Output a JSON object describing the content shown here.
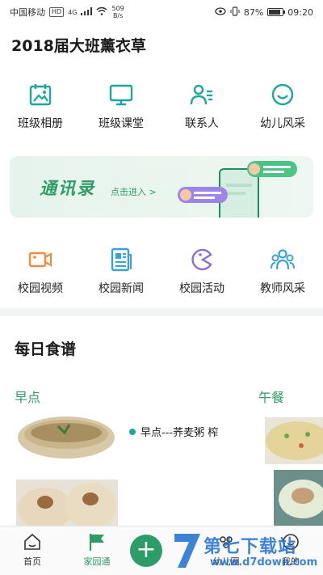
{
  "status_bar": {
    "carrier": "中国移动",
    "hd": "HD",
    "network": "4G",
    "speed_value": "509",
    "speed_unit": "B/s",
    "battery_percent": "87%",
    "battery_level": 0.87,
    "time": "09:20"
  },
  "header": {
    "title": "2018届大班薰衣草"
  },
  "quick_grid_1": [
    {
      "label": "班级相册",
      "icon": "album-icon"
    },
    {
      "label": "班级课堂",
      "icon": "classroom-icon"
    },
    {
      "label": "联系人",
      "icon": "contacts-icon"
    },
    {
      "label": "幼儿风采",
      "icon": "smile-icon"
    }
  ],
  "banner": {
    "title": "通讯录",
    "subtitle": "点击进入 >"
  },
  "quick_grid_2": [
    {
      "label": "校园视频",
      "icon": "video-icon"
    },
    {
      "label": "校园新闻",
      "icon": "news-icon"
    },
    {
      "label": "校园活动",
      "icon": "activity-icon"
    },
    {
      "label": "教师风采",
      "icon": "teachers-icon"
    }
  ],
  "recipes": {
    "section_title": "每日食谱",
    "meals": [
      {
        "label": "早点",
        "caption": "早点---荞麦粥 榨"
      },
      {
        "label": "午餐"
      }
    ]
  },
  "tab_bar": {
    "tabs": [
      {
        "label": "首页",
        "icon": "home-icon"
      },
      {
        "label": "家园通",
        "icon": "flag-icon",
        "active": true
      },
      {
        "label": "",
        "icon": "plus-icon"
      },
      {
        "label": "幼儿圈",
        "icon": "circle-icon"
      },
      {
        "label": "我的",
        "icon": "profile-icon"
      }
    ]
  },
  "watermark": {
    "text": "第七下载站",
    "url": "www.d7down.com"
  },
  "colors": {
    "accent": "#2e9c67",
    "teal": "#1fa59a",
    "orange": "#f08a3e",
    "blue": "#3aa0d8",
    "purple": "#8b6fd6"
  }
}
